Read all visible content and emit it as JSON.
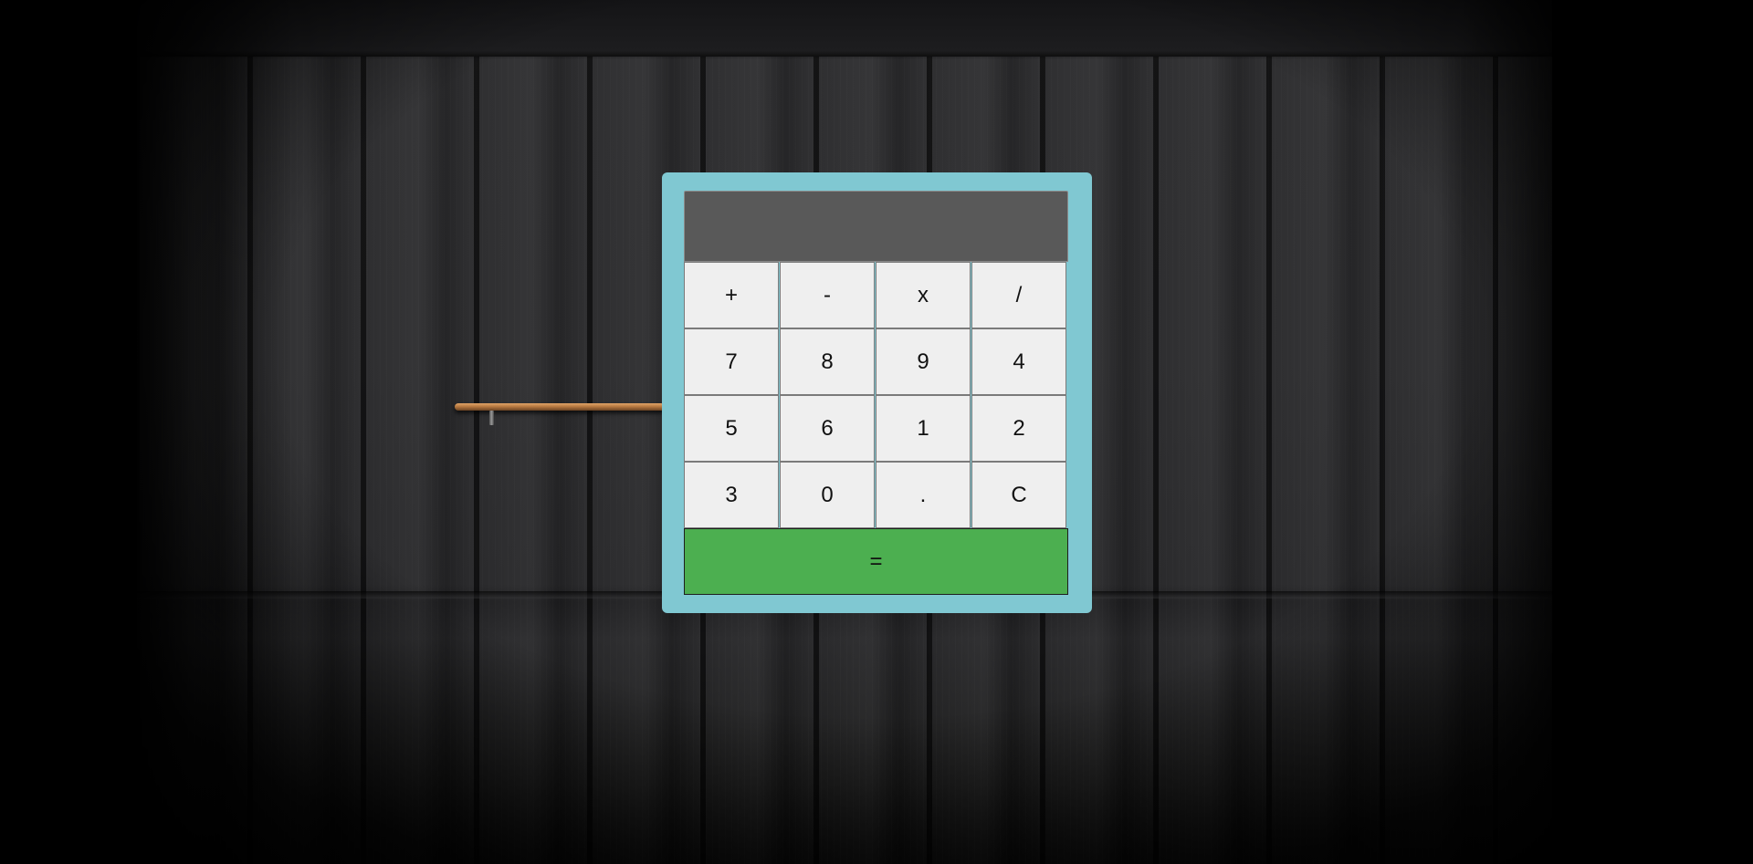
{
  "display": {
    "value": ""
  },
  "keys": {
    "row1": [
      "+",
      "-",
      "x",
      "/"
    ],
    "row2": [
      "7",
      "8",
      "9",
      "4"
    ],
    "row3": [
      "5",
      "6",
      "1",
      "2"
    ],
    "row4": [
      "3",
      "0",
      ".",
      "C"
    ]
  },
  "equals_label": "=",
  "colors": {
    "frame": "#80c8d2",
    "display": "#595959",
    "key": "#efefef",
    "equals": "#4caf50",
    "rod": "#b87a41"
  }
}
